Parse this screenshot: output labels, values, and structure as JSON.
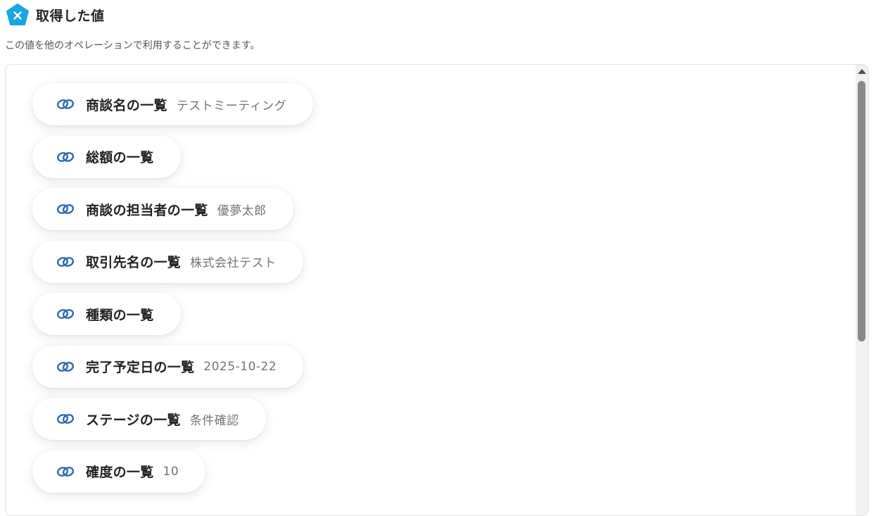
{
  "header": {
    "title": "取得した値",
    "logo_icon": "x-pentagon-icon",
    "logo_color": "#1aa7e0"
  },
  "subtitle": "この値を他のオペレーションで利用することができます。",
  "items": [
    {
      "label": "商談名の一覧",
      "value": "テストミーティング",
      "icon": "link-icon"
    },
    {
      "label": "総額の一覧",
      "value": "",
      "icon": "link-icon"
    },
    {
      "label": "商談の担当者の一覧",
      "value": "優夢太郎",
      "icon": "link-icon"
    },
    {
      "label": "取引先名の一覧",
      "value": "株式会社テスト",
      "icon": "link-icon"
    },
    {
      "label": "種類の一覧",
      "value": "",
      "icon": "link-icon"
    },
    {
      "label": "完了予定日の一覧",
      "value": "2025-10-22",
      "icon": "link-icon"
    },
    {
      "label": "ステージの一覧",
      "value": "条件確認",
      "icon": "link-icon"
    },
    {
      "label": "確度の一覧",
      "value": "10",
      "icon": "link-icon"
    }
  ],
  "colors": {
    "link_icon": "#2f6bb0",
    "label": "#222222",
    "value": "#737373"
  }
}
